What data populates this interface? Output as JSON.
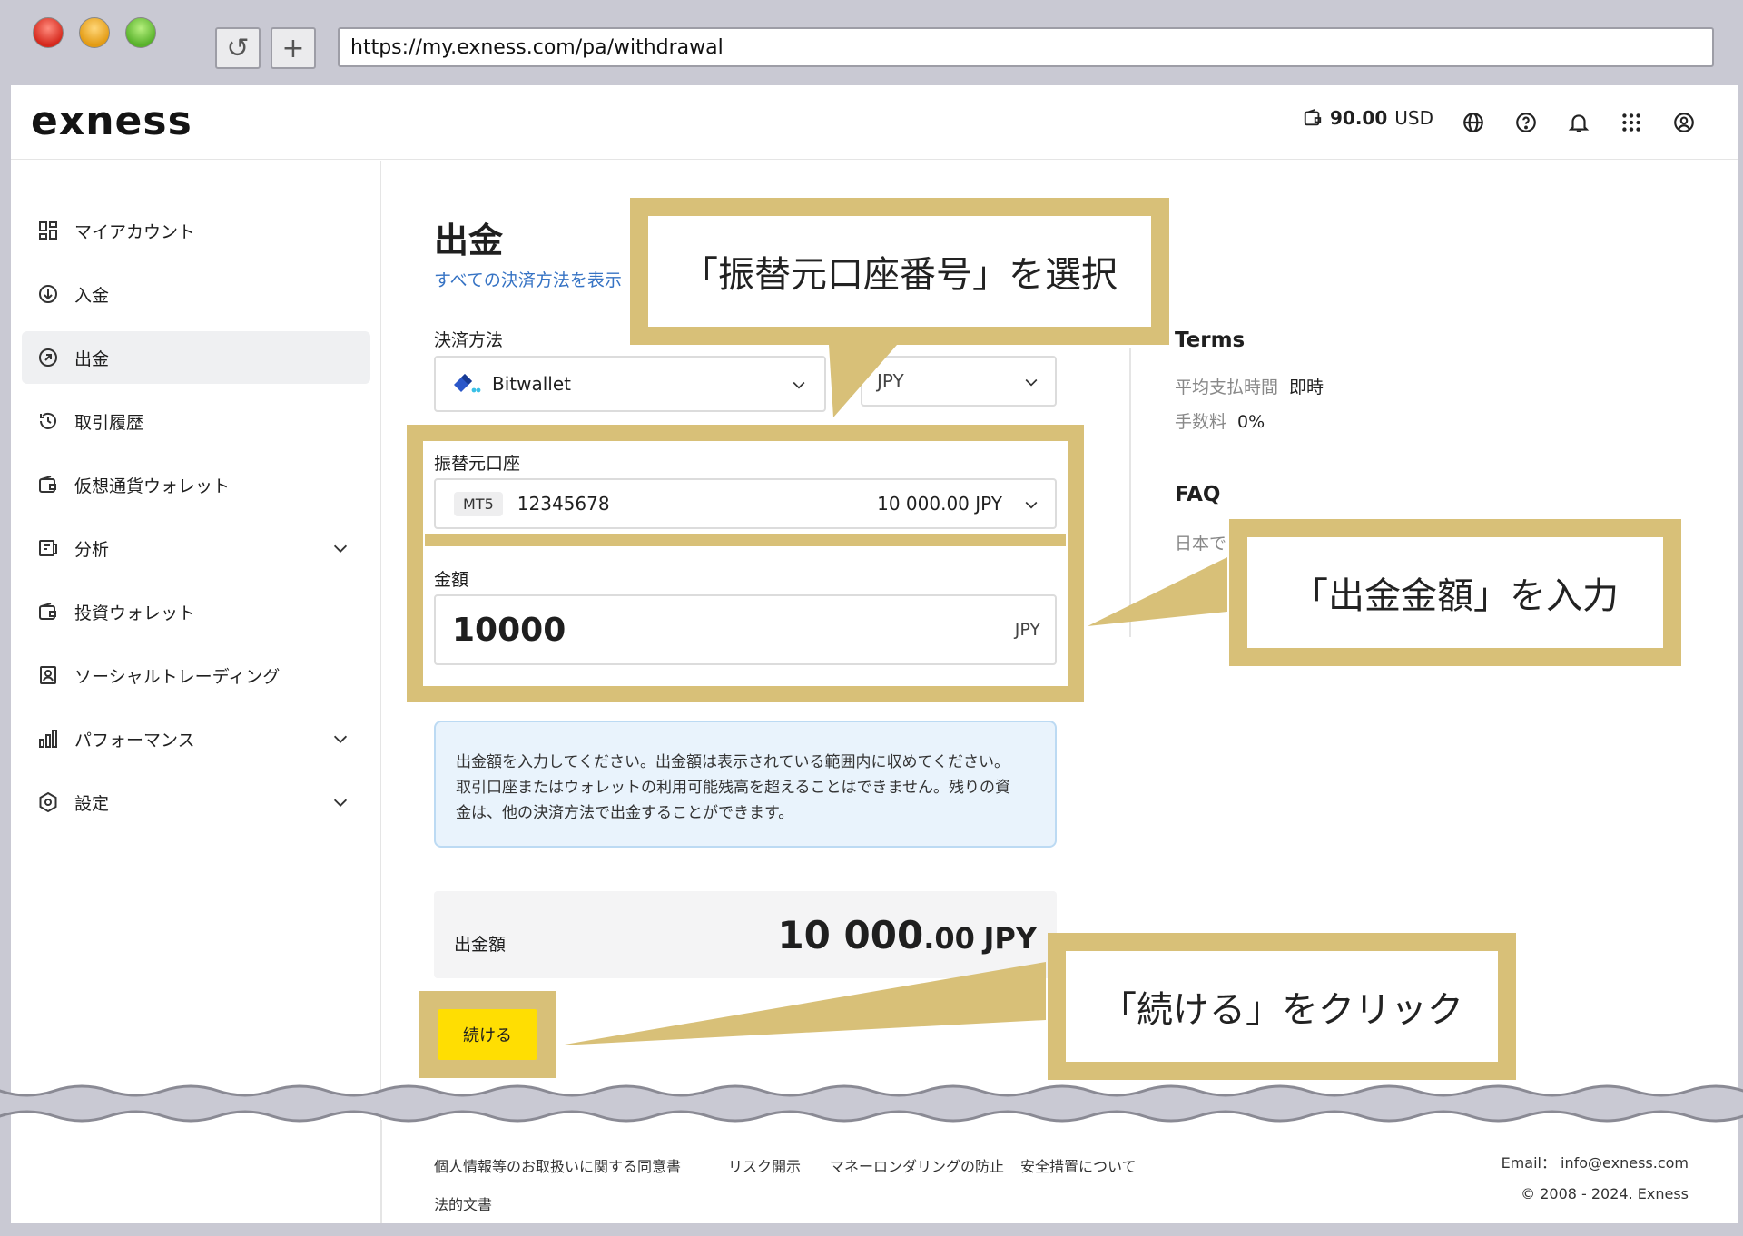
{
  "browser": {
    "url": "https://my.exness.com/pa/withdrawal",
    "reload_glyph": "↺",
    "newtab_glyph": "+"
  },
  "header": {
    "logo": "exness",
    "balance_amount": "90.00",
    "balance_currency": "USD"
  },
  "sidebar": {
    "items": [
      {
        "label": "マイアカウント",
        "icon": "dashboard-icon"
      },
      {
        "label": "入金",
        "icon": "deposit-icon"
      },
      {
        "label": "出金",
        "icon": "withdraw-icon",
        "active": true
      },
      {
        "label": "取引履歴",
        "icon": "history-icon"
      },
      {
        "label": "仮想通貨ウォレット",
        "icon": "wallet-icon"
      },
      {
        "label": "分析",
        "icon": "analytics-icon",
        "expandable": true
      },
      {
        "label": "投資ウォレット",
        "icon": "wallet-icon"
      },
      {
        "label": "ソーシャルトレーディング",
        "icon": "social-trading-icon"
      },
      {
        "label": "パフォーマンス",
        "icon": "performance-icon",
        "expandable": true
      },
      {
        "label": "設定",
        "icon": "settings-icon",
        "expandable": true
      }
    ]
  },
  "main": {
    "title": "出金",
    "show_all": "すべての決済方法を表示",
    "payment_method_label": "決済方法",
    "payment_method_value": "Bitwallet",
    "currency_value": "JPY",
    "source_account_label": "振替元口座",
    "account_platform": "MT5",
    "account_number": "12345678",
    "account_balance": "10 000.00 JPY",
    "amount_label": "金額",
    "amount_value": "10000",
    "amount_currency": "JPY",
    "info_text_1": "出金額を入力してください。出金額は表示されている範囲内に収めてください。",
    "info_text_2": "取引口座またはウォレットの利用可能残高を超えることはできません。残りの資",
    "info_text_3": "金は、他の決済方法で出金することができます。",
    "total_label": "出金額",
    "total_major": "10 000",
    "total_minor": ".00",
    "total_currency": "JPY",
    "continue_button": "続ける"
  },
  "terms": {
    "title": "Terms",
    "avg_time_label": "平均支払時間",
    "avg_time_value": "即時",
    "fee_label": "手数料",
    "fee_value": "0%",
    "faq_title": "FAQ",
    "faq_text": "日本で"
  },
  "callouts": {
    "select_account": "「振替元口座番号」を選択",
    "enter_amount": "「出金金額」を入力",
    "click_continue": "「続ける」をクリック"
  },
  "footer": {
    "links": [
      "個人情報等のお取扱いに関する同意書",
      "リスク開示",
      "マネーロンダリングの防止",
      "安全措置について",
      "法的文書"
    ],
    "email": "Email： info@exness.com",
    "copyright": "© 2008 - 2024. Exness"
  },
  "colors": {
    "callout": "#d8c078",
    "accent_yellow": "#ffde02",
    "link_blue": "#3673c4",
    "info_bg": "#e9f3fc"
  }
}
